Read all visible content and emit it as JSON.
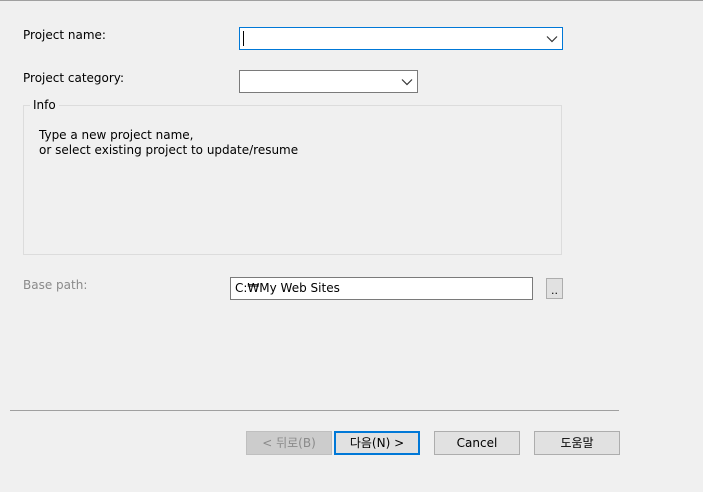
{
  "form": {
    "project_name_label": "Project name:",
    "project_name_value": "",
    "project_category_label": "Project category:",
    "project_category_value": "",
    "info_title": "Info",
    "info_line1": "Type a new project name,",
    "info_line2": "or select existing project to update/resume",
    "base_path_label": "Base path:",
    "base_path_value": "C:₩My Web Sites",
    "browse_label": ".."
  },
  "buttons": {
    "back": "< 뒤로(B)",
    "next": "다음(N) >",
    "cancel": "Cancel",
    "help": "도움말"
  },
  "icons": {
    "dropdown": "chevron-down-icon"
  },
  "colors": {
    "background": "#f0f0f0",
    "focus_border": "#0078d7",
    "disabled_text": "#8a8a8a"
  }
}
